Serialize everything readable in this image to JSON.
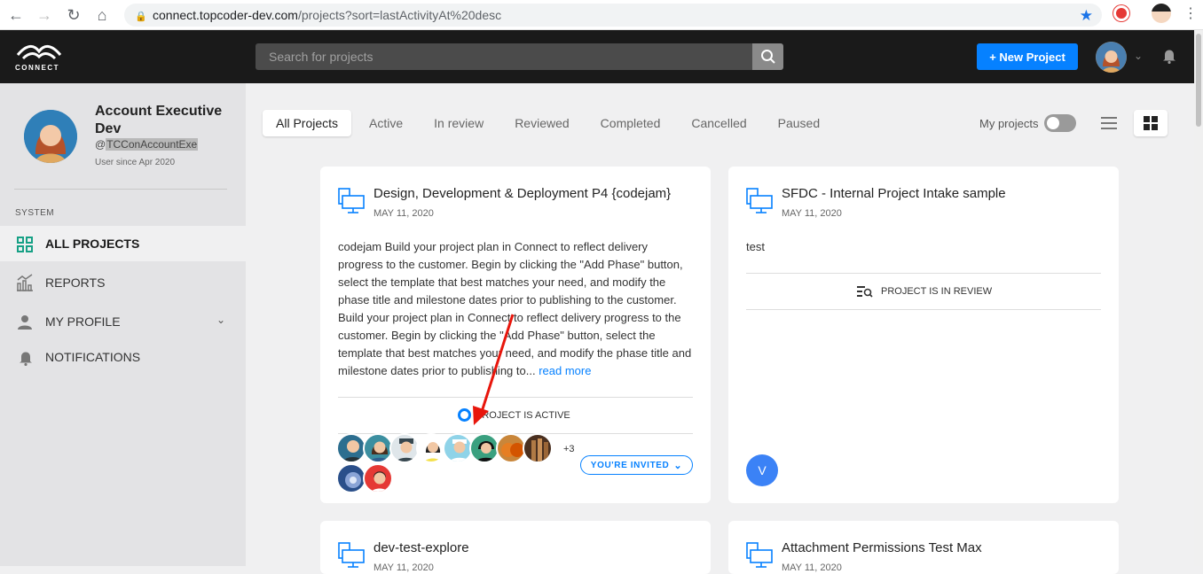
{
  "browser": {
    "url_host": "connect.topcoder-dev.com",
    "url_path": "/projects?sort=lastActivityAt%20desc"
  },
  "header": {
    "logo_text": "CONNECT",
    "search_placeholder": "Search for projects",
    "new_project_label": "+ New Project"
  },
  "sidebar": {
    "user_name": "Account Executive Dev",
    "user_handle_at": "@",
    "user_handle": "TCConAccountExe",
    "user_since": "User since Apr 2020",
    "section_label": "SYSTEM",
    "items": [
      {
        "label": "ALL PROJECTS"
      },
      {
        "label": "REPORTS"
      },
      {
        "label": "MY PROFILE"
      },
      {
        "label": "NOTIFICATIONS"
      }
    ]
  },
  "filters": {
    "tabs": [
      {
        "label": "All Projects"
      },
      {
        "label": "Active"
      },
      {
        "label": "In review"
      },
      {
        "label": "Reviewed"
      },
      {
        "label": "Completed"
      },
      {
        "label": "Cancelled"
      },
      {
        "label": "Paused"
      }
    ],
    "my_projects_label": "My projects",
    "my_projects_on": false
  },
  "projects": [
    {
      "title": "Design, Development & Deployment P4 {codejam}",
      "date": "MAY 11, 2020",
      "description": "codejam Build your project plan in Connect to reflect delivery progress to the customer. Begin by clicking the \"Add Phase\" button, select the template that best matches your need, and modify the phase title and milestone dates prior to publishing to the customer. Build your project plan in Connect to reflect delivery progress to the customer. Begin by clicking the \"Add Phase\" button, select the template that best matches your need, and modify the phase title and milestone dates prior to publishing to...",
      "read_more": "read more",
      "status": "PROJECT IS ACTIVE",
      "extra_members": "+3",
      "invite_label": "YOU'RE INVITED"
    },
    {
      "title": "SFDC - Internal Project Intake sample",
      "date": "MAY 11, 2020",
      "description": "test",
      "status": "PROJECT IS IN REVIEW",
      "member_initial": "V"
    },
    {
      "title": "dev-test-explore",
      "date": "MAY 11, 2020"
    },
    {
      "title": "Attachment Permissions Test Max",
      "date": "MAY 11, 2020"
    }
  ],
  "colors": {
    "accent": "#0681ff",
    "header_bg": "#1a1a1a",
    "sidebar_bg": "#e3e3e5",
    "active_icon": "#16a085"
  }
}
